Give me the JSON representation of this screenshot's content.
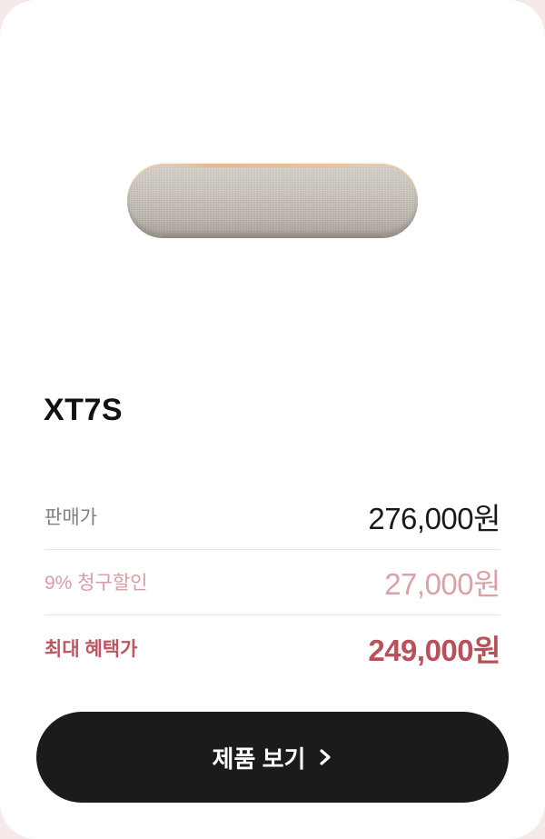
{
  "product": {
    "name": "XT7S",
    "image_icon": "soundbar-speaker-image"
  },
  "prices": {
    "sale": {
      "label": "판매가",
      "value": "276,000원"
    },
    "discount": {
      "label": "9% 청구할인",
      "value": "27,000원"
    },
    "benefit": {
      "label": "최대 혜택가",
      "value": "249,000원"
    }
  },
  "cta": {
    "label": "제품 보기",
    "icon": "chevron-right-icon"
  },
  "colors": {
    "page_background": "#f6e9ea",
    "card": "#ffffff",
    "button": "#1b1b1b",
    "discount_text": "#d9a2a6",
    "benefit_text": "#b9505b"
  }
}
